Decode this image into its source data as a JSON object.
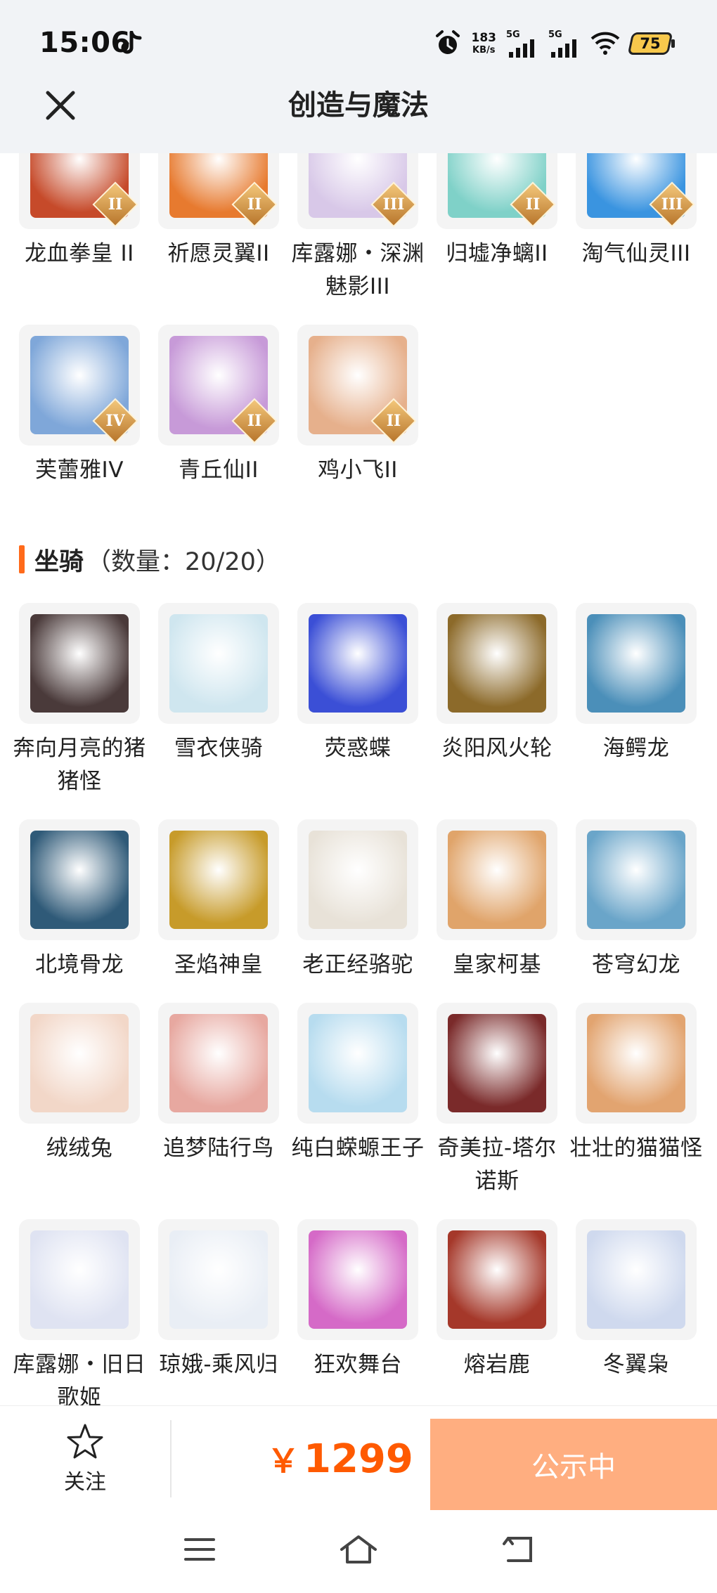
{
  "status_bar": {
    "time": "15:06",
    "net_speed_value": "183",
    "net_speed_unit": "KB/s",
    "signal1_label": "5G",
    "signal2_label": "5G",
    "battery": "75"
  },
  "header": {
    "title": "创造与魔法"
  },
  "top_items": [
    {
      "name": "龙血拳皇 II",
      "tier": "II",
      "color": "#c64a2a",
      "icon": "red-dragon-warrior-icon"
    },
    {
      "name": "祈愿灵翼II",
      "tier": "II",
      "color": "#e77a2f",
      "icon": "eagle-icon"
    },
    {
      "name": "库露娜・深渊魅影III",
      "tier": "III",
      "color": "#d8c8e8",
      "icon": "white-haired-girl-icon"
    },
    {
      "name": "归墟净螭II",
      "tier": "II",
      "color": "#7fd1c8",
      "icon": "water-dragon-icon"
    },
    {
      "name": "淘气仙灵III",
      "tier": "III",
      "color": "#3a94e0",
      "icon": "blue-puppy-icon"
    },
    {
      "name": "芙蕾雅IV",
      "tier": "IV",
      "color": "#7fa7d9",
      "icon": "valkyrie-icon"
    },
    {
      "name": "青丘仙II",
      "tier": "II",
      "color": "#c79ad8",
      "icon": "fox-fairy-icon"
    },
    {
      "name": "鸡小飞II",
      "tier": "II",
      "color": "#e6b08c",
      "icon": "chick-muscle-icon"
    }
  ],
  "mounts_section": {
    "title": "坐骑",
    "count_label": "（数量：20/20）"
  },
  "mounts": [
    {
      "name": "奔向月亮的猪猪怪",
      "color": "#4a3a3a",
      "icon": "black-pig-icon"
    },
    {
      "name": "雪衣侠骑",
      "color": "#cfe6ef",
      "icon": "white-horse-icon"
    },
    {
      "name": "荧惑蝶",
      "color": "#3b4fd6",
      "icon": "blue-butterfly-icon"
    },
    {
      "name": "炎阳风火轮",
      "color": "#8c6a2a",
      "icon": "fire-wheel-icon"
    },
    {
      "name": "海鳄龙",
      "color": "#4b8fb9",
      "icon": "sea-dragon-icon"
    },
    {
      "name": "北境骨龙",
      "color": "#2f5a78",
      "icon": "bone-dragon-icon"
    },
    {
      "name": "圣焰神皇",
      "color": "#c79b2a",
      "icon": "golden-phoenix-icon"
    },
    {
      "name": "老正经骆驼",
      "color": "#e8e2d8",
      "icon": "camel-icon"
    },
    {
      "name": "皇家柯基",
      "color": "#e0a46a",
      "icon": "corgi-icon"
    },
    {
      "name": "苍穹幻龙",
      "color": "#6aa5c9",
      "icon": "sky-dragon-icon"
    },
    {
      "name": "绒绒兔",
      "color": "#f2d7c8",
      "icon": "fluffy-rabbit-icon"
    },
    {
      "name": "追梦陆行鸟",
      "color": "#e7a8a0",
      "icon": "ostrich-icon"
    },
    {
      "name": "纯白蝾螈王子",
      "color": "#b7dcef",
      "icon": "axolotl-icon"
    },
    {
      "name": "奇美拉-塔尔诺斯",
      "color": "#7a2a2a",
      "icon": "chimera-icon"
    },
    {
      "name": "壮壮的猫猫怪",
      "color": "#e2a470",
      "icon": "cat-icon"
    },
    {
      "name": "库露娜・旧日歌姬",
      "color": "#dfe3f2",
      "icon": "singer-girl-icon"
    },
    {
      "name": "琼娥-乘风归",
      "color": "#e9eef5",
      "icon": "fairy-girl-icon"
    },
    {
      "name": "狂欢舞台",
      "color": "#d56ac7",
      "icon": "heart-stage-icon"
    },
    {
      "name": "熔岩鹿",
      "color": "#a5382a",
      "icon": "lava-deer-icon"
    },
    {
      "name": "冬翼枭",
      "color": "#cfd9ee",
      "icon": "winter-owl-icon"
    }
  ],
  "action_bar": {
    "follow_label": "关注",
    "currency": "￥",
    "price": "1299",
    "status_button": "公示中"
  },
  "colors": {
    "accent": "#ff5a00",
    "button": "#ffae80",
    "section_bar": "#ff6a1a"
  }
}
